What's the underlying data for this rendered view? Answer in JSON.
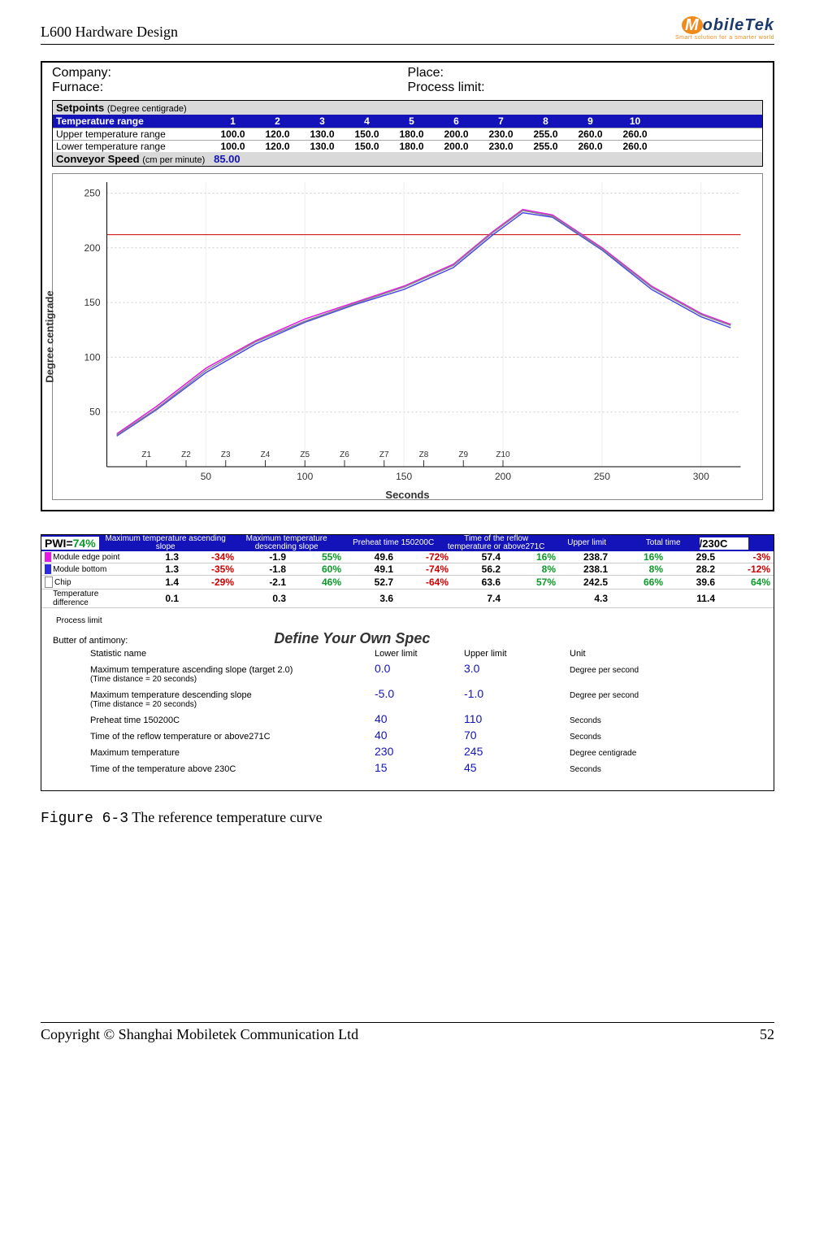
{
  "header": {
    "title": "L600 Hardware Design",
    "logo_main": "MobileTek",
    "logo_tag": "Smart solution for a smarter world"
  },
  "info": {
    "company": "Company:",
    "furnace": "Furnace:",
    "place": "Place:",
    "process_limit": "Process limit:"
  },
  "setpoints": {
    "title": "Setpoints",
    "dc": "(Degree centigrade)",
    "range_label": "Temperature range",
    "zones": [
      "1",
      "2",
      "3",
      "4",
      "5",
      "6",
      "7",
      "8",
      "9",
      "10"
    ],
    "upper_label": "Upper temperature range",
    "upper_vals": [
      "100.0",
      "120.0",
      "130.0",
      "150.0",
      "180.0",
      "200.0",
      "230.0",
      "255.0",
      "260.0",
      "260.0"
    ],
    "lower_label": "Lower temperature range",
    "lower_vals": [
      "100.0",
      "120.0",
      "130.0",
      "150.0",
      "180.0",
      "200.0",
      "230.0",
      "255.0",
      "260.0",
      "260.0"
    ],
    "conv_label": "Conveyor Speed",
    "conv_unit": "(cm per minute)",
    "conv_val": "85.00"
  },
  "chart_data": {
    "type": "line",
    "xlabel": "Seconds",
    "ylabel": "Degree centigrade",
    "xlim": [
      0,
      320
    ],
    "ylim": [
      0,
      260
    ],
    "x_ticks": [
      50,
      100,
      150,
      200,
      250,
      300
    ],
    "y_ticks": [
      50,
      100,
      150,
      200,
      250
    ],
    "zone_markers": [
      "Z1",
      "Z2",
      "Z3",
      "Z4",
      "Z5",
      "Z6",
      "Z7",
      "Z8",
      "Z9",
      "Z10"
    ],
    "zone_x": [
      20,
      40,
      60,
      80,
      100,
      120,
      140,
      160,
      180,
      200
    ],
    "ref_line_y": 212,
    "series": [
      {
        "name": "Module edge point",
        "color": "#e419e4",
        "x": [
          5,
          25,
          50,
          75,
          100,
          125,
          150,
          175,
          195,
          210,
          225,
          250,
          275,
          300,
          315
        ],
        "y": [
          30,
          55,
          90,
          115,
          135,
          150,
          165,
          185,
          215,
          235,
          230,
          200,
          165,
          140,
          130
        ]
      },
      {
        "name": "Module bottom",
        "color": "#4a4ae6",
        "x": [
          5,
          25,
          50,
          75,
          100,
          125,
          150,
          175,
          195,
          210,
          225,
          250,
          275,
          300,
          315
        ],
        "y": [
          28,
          52,
          86,
          112,
          132,
          148,
          162,
          182,
          212,
          232,
          228,
          198,
          162,
          137,
          127
        ]
      },
      {
        "name": "Chip",
        "color": "#888",
        "x": [
          5,
          25,
          50,
          75,
          100,
          125,
          150,
          175,
          195,
          210,
          225,
          250,
          275,
          300,
          315
        ],
        "y": [
          29,
          53,
          88,
          114,
          133,
          149,
          164,
          184,
          214,
          234,
          229,
          199,
          164,
          139,
          129
        ]
      }
    ]
  },
  "stats": {
    "pwi_label": "PWI=",
    "pwi_pct": "74%",
    "end_label": "/230C",
    "headers": {
      "h1": "Maximum temperature ascending slope",
      "h2": "Maximum temperature descending slope",
      "h3": "Preheat time 150200C",
      "h4": "Time of the reflow temperature or above271C",
      "h5": "Upper limit",
      "h6": "Total time"
    },
    "rows": [
      {
        "name": "Module edge point",
        "color": "m-pink",
        "cells": [
          [
            "1.3",
            "-34%"
          ],
          [
            "-1.9",
            "55%"
          ],
          [
            "49.6",
            "-72%"
          ],
          [
            "57.4",
            "16%"
          ],
          [
            "238.7",
            "16%"
          ],
          [
            "29.5",
            "-3%"
          ]
        ]
      },
      {
        "name": "Module bottom",
        "color": "m-blue",
        "cells": [
          [
            "1.3",
            "-35%"
          ],
          [
            "-1.8",
            "60%"
          ],
          [
            "49.1",
            "-74%"
          ],
          [
            "56.2",
            "8%"
          ],
          [
            "238.1",
            "8%"
          ],
          [
            "28.2",
            "-12%"
          ]
        ]
      },
      {
        "name": "Chip",
        "color": "m-white",
        "cells": [
          [
            "1.4",
            "-29%"
          ],
          [
            "-2.1",
            "46%"
          ],
          [
            "52.7",
            "-64%"
          ],
          [
            "63.6",
            "57%"
          ],
          [
            "242.5",
            "66%"
          ],
          [
            "39.6",
            "64%"
          ]
        ]
      },
      {
        "name": "Temperature difference",
        "color": "",
        "cells": [
          [
            "0.1",
            ""
          ],
          [
            "0.3",
            ""
          ],
          [
            "3.6",
            ""
          ],
          [
            "7.4",
            ""
          ],
          [
            "4.3",
            ""
          ],
          [
            "11.4",
            ""
          ]
        ]
      }
    ],
    "process_limit": "Process limit",
    "butter": "Butter of antimony:",
    "spec_head": "Define Your Own Spec",
    "spec_cols": {
      "stat": "Statistic name",
      "ll": "Lower limit",
      "ul": "Upper limit",
      "un": "Unit"
    },
    "spec_rows": [
      {
        "name": "Maximum temperature ascending slope (target  2.0)",
        "sub": "(Time distance = 20 seconds)",
        "ll": "0.0",
        "ul": "3.0",
        "un": "Degree per second"
      },
      {
        "name": "Maximum temperature descending slope",
        "sub": "(Time distance = 20 seconds)",
        "ll": "-5.0",
        "ul": "-1.0",
        "un": "Degree per second"
      },
      {
        "name": "Preheat time 150200C",
        "sub": "",
        "ll": "40",
        "ul": "110",
        "un": "Seconds"
      },
      {
        "name": "Time of the reflow temperature or above271C",
        "sub": "",
        "ll": "40",
        "ul": "70",
        "un": "Seconds"
      },
      {
        "name": "Maximum temperature",
        "sub": "",
        "ll": "230",
        "ul": "245",
        "un": "Degree centigrade"
      },
      {
        "name": "Time of the temperature above 230C",
        "sub": "",
        "ll": "15",
        "ul": "45",
        "un": "Seconds"
      }
    ]
  },
  "caption": {
    "fignum": "Figure 6-3",
    "text": "The reference temperature curve"
  },
  "footer": {
    "copy": "Copyright  ©  Shanghai  Mobiletek  Communication  Ltd",
    "page": "52"
  }
}
